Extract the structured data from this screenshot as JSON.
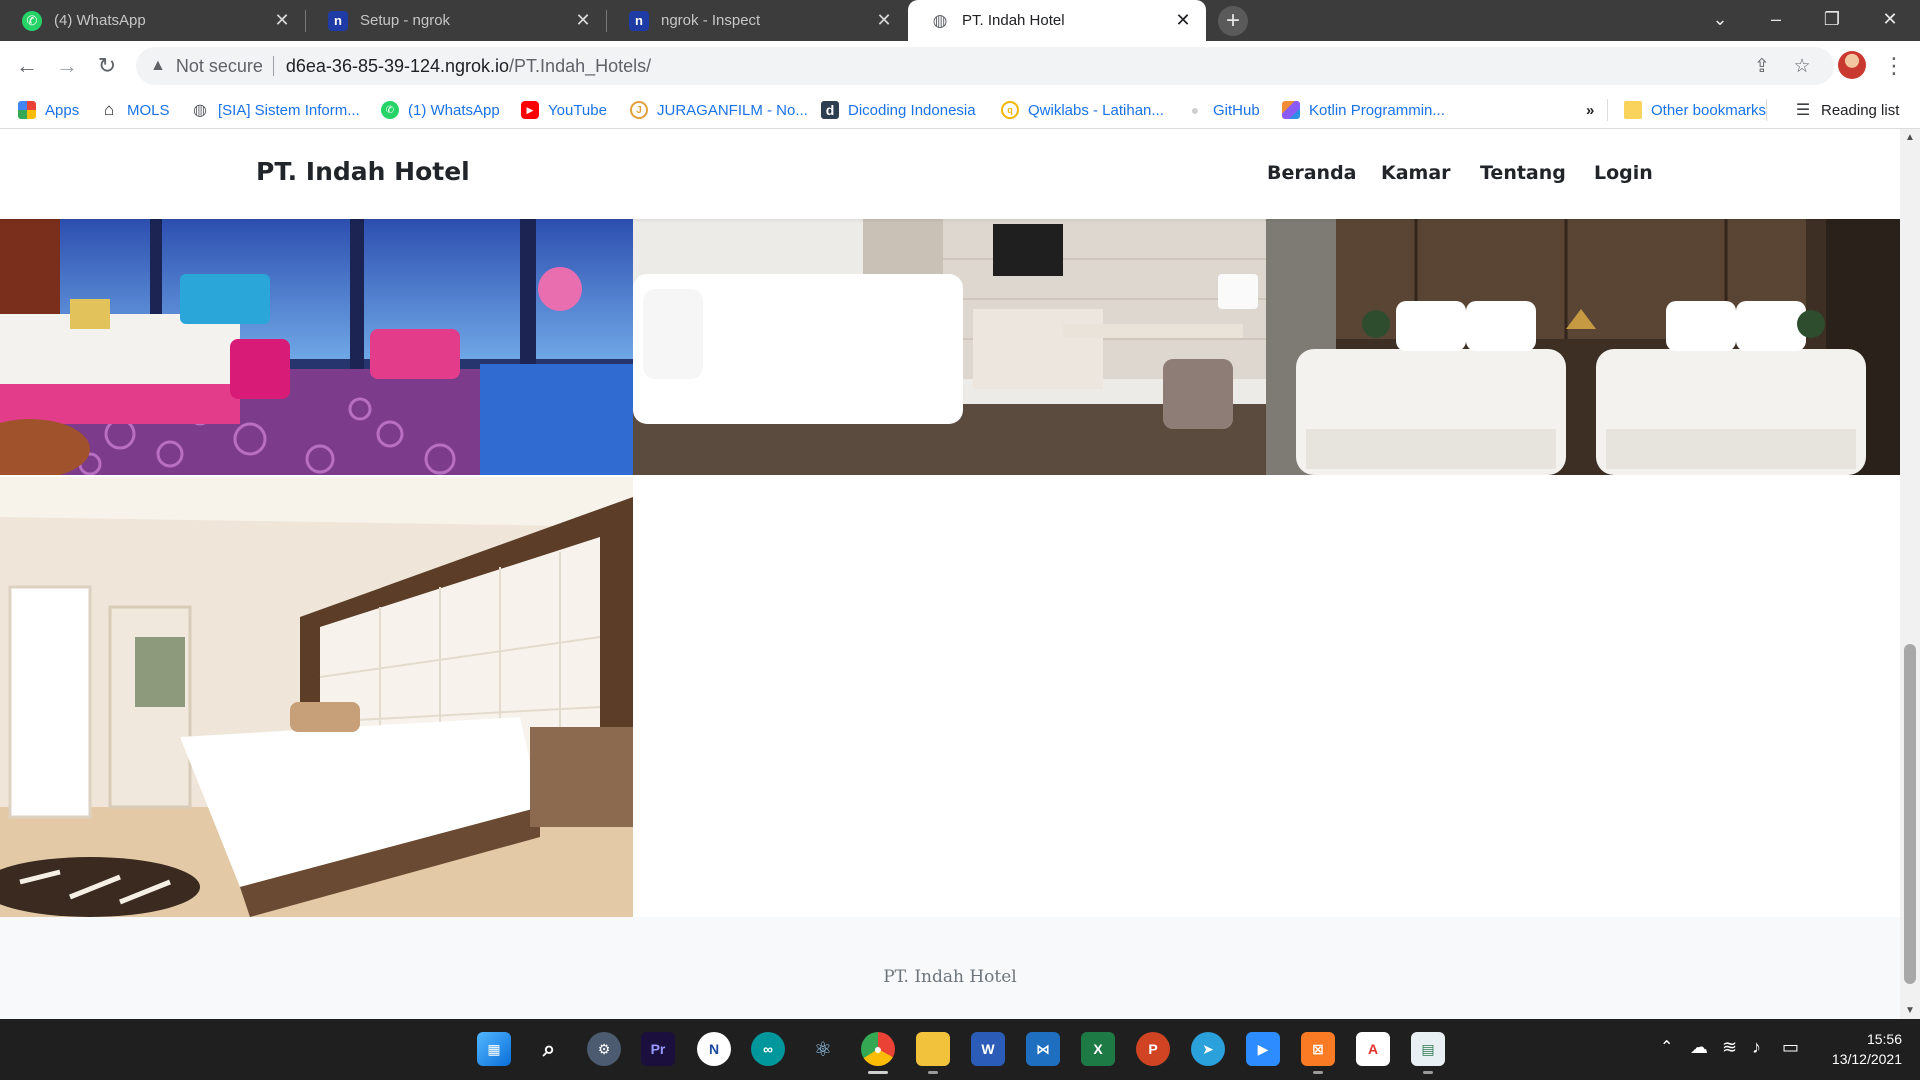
{
  "browser": {
    "tabs": [
      {
        "title": "(4) WhatsApp",
        "icon": "whatsapp-icon",
        "active": false
      },
      {
        "title": "Setup - ngrok",
        "icon": "ngrok-icon",
        "active": false
      },
      {
        "title": "ngrok - Inspect",
        "icon": "ngrok-icon",
        "active": false
      },
      {
        "title": "PT. Indah Hotel",
        "icon": "globe-icon",
        "active": true
      }
    ],
    "address": {
      "security_label": "Not secure",
      "host": "d6ea-36-85-39-124.ngrok.io",
      "path": "/PT.Indah_Hotels/"
    },
    "bookmarks": [
      {
        "label": "Apps",
        "icon": "apps-grid-icon"
      },
      {
        "label": "MOLS",
        "icon": "home-icon"
      },
      {
        "label": "[SIA] Sistem Inform...",
        "icon": "globe-icon"
      },
      {
        "label": "(1) WhatsApp",
        "icon": "whatsapp-icon"
      },
      {
        "label": "YouTube",
        "icon": "youtube-icon"
      },
      {
        "label": "JURAGANFILM - No...",
        "icon": "film-icon"
      },
      {
        "label": "Dicoding Indonesia",
        "icon": "dicoding-icon"
      },
      {
        "label": "Qwiklabs - Latihan...",
        "icon": "qwiklabs-icon"
      },
      {
        "label": "GitHub",
        "icon": "github-icon"
      },
      {
        "label": "Kotlin Programmin...",
        "icon": "kotlin-icon"
      }
    ],
    "overflow_label": "»",
    "other_bookmarks": "Other bookmarks",
    "reading_list": "Reading list"
  },
  "site": {
    "brand": "PT. Indah Hotel",
    "nav": [
      "Beranda",
      "Kamar",
      "Tentang",
      "Login"
    ],
    "rooms": [
      {
        "name": "room-photo-colorful-suite",
        "accent": "#c21f7a"
      },
      {
        "name": "room-photo-white-modern",
        "accent": "#d9d3ca"
      },
      {
        "name": "room-photo-twin-beds-dark",
        "accent": "#5a4636"
      },
      {
        "name": "room-photo-cream-bedroom",
        "accent": "#e4d6c0"
      }
    ],
    "footer_text": "PT. Indah Hotel"
  },
  "taskbar": {
    "apps": [
      "start-icon",
      "search-icon",
      "settings-icon",
      "premiere-icon",
      "app-icon",
      "arduino-icon",
      "atom-icon",
      "chrome-icon",
      "file-explorer-icon",
      "word-icon",
      "vscode-icon",
      "excel-icon",
      "powerpoint-icon",
      "telegram-icon",
      "zoom-icon",
      "xampp-icon",
      "acrobat-icon",
      "notepad-icon"
    ],
    "time": "15:56",
    "date": "13/12/2021"
  }
}
